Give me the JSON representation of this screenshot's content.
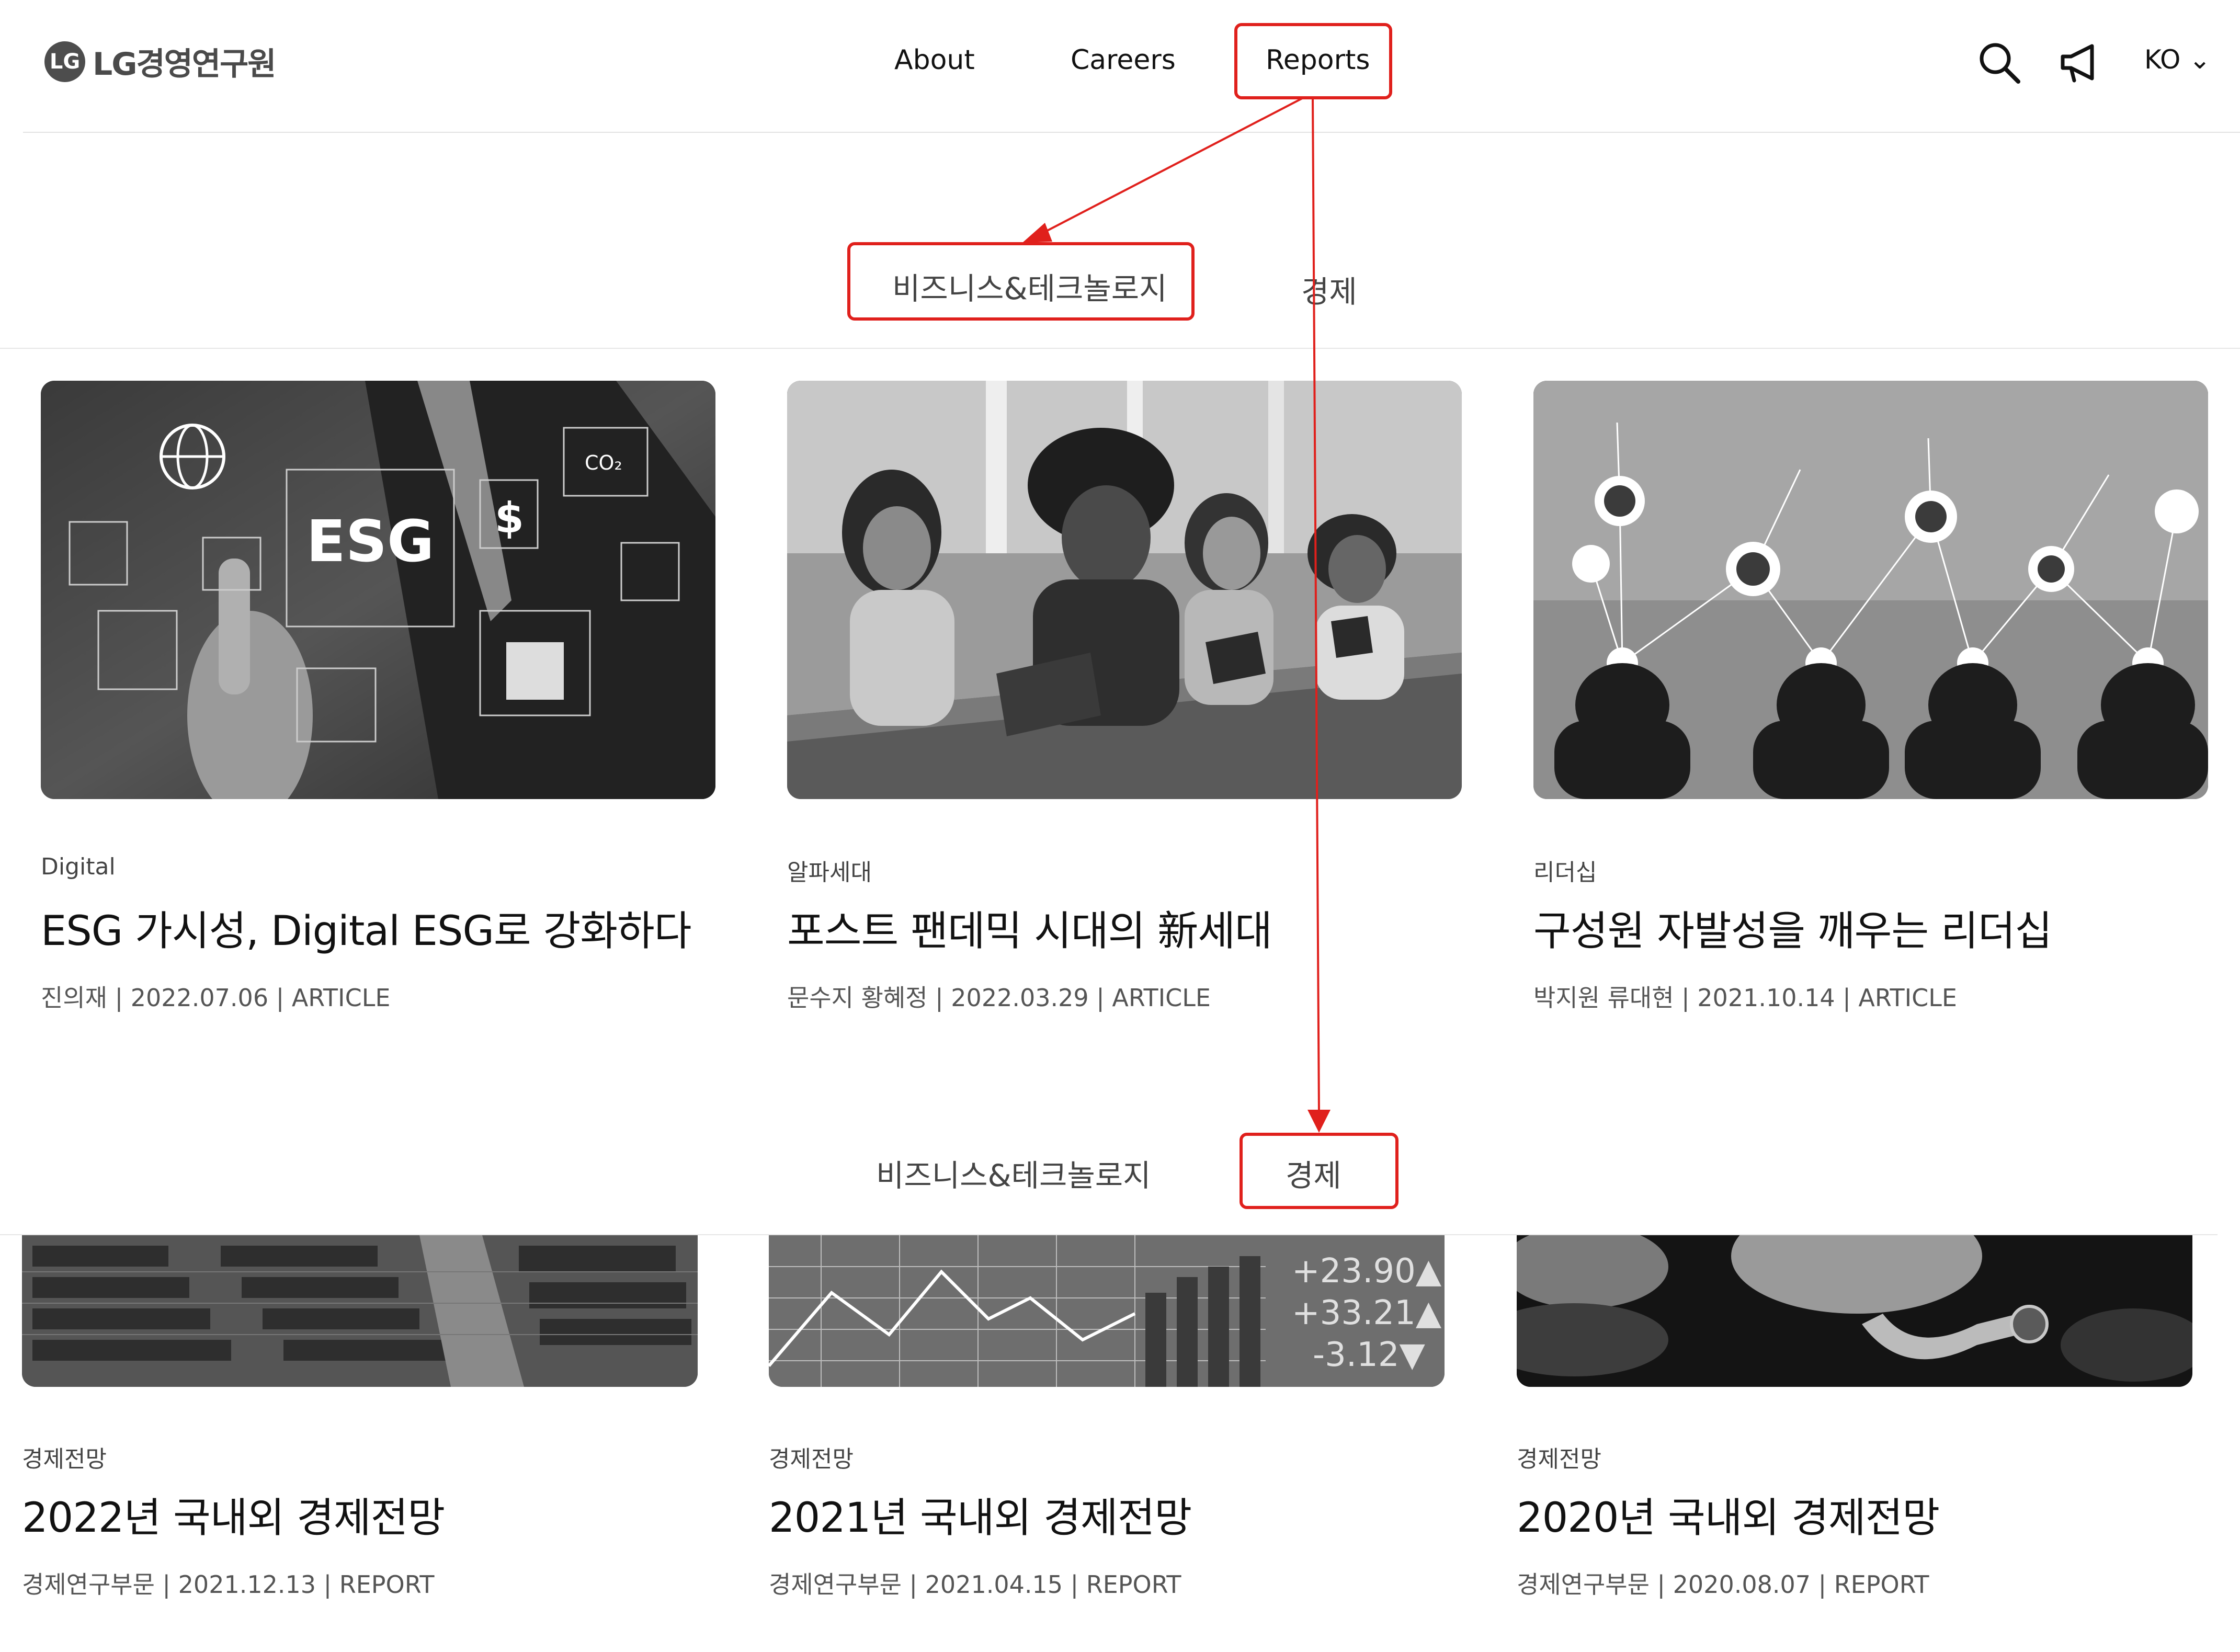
{
  "header": {
    "logo_mark": "LG",
    "logo_text": "LG경영연구원",
    "nav": [
      "About",
      "Careers",
      "Reports"
    ],
    "language": "KO ⌄",
    "icons": [
      "search-icon",
      "megaphone-icon",
      "chevron-down-icon"
    ]
  },
  "section1": {
    "tabs": [
      "비즈니스&테크놀로지",
      "경제"
    ],
    "cards": [
      {
        "category": "Digital",
        "title": "ESG 가시성, Digital ESG로 강화하다",
        "meta": "진의재 | 2022.07.06 | ARTICLE"
      },
      {
        "category": "알파세대",
        "title": "포스트 팬데믹 시대의 新세대",
        "meta": "문수지 황혜정 | 2022.03.29 | ARTICLE"
      },
      {
        "category": "리더십",
        "title": "구성원 자발성을 깨우는 리더십",
        "meta": "박지원 류대현 | 2021.10.14 | ARTICLE"
      }
    ]
  },
  "section2": {
    "tabs": [
      "비즈니스&테크놀로지",
      "경제"
    ],
    "cards": [
      {
        "category": "경제전망",
        "title": "2022년 국내외 경제전망",
        "meta": "경제연구부문 | 2021.12.13 | REPORT"
      },
      {
        "category": "경제전망",
        "title": "2021년 국내외 경제전망",
        "meta": "경제연구부문 | 2021.04.15 | REPORT"
      },
      {
        "category": "경제전망",
        "title": "2020년 국내외 경제전망",
        "meta": "경제연구부문 | 2020.08.07 | REPORT"
      }
    ]
  },
  "image_text": {
    "esg": "ESG",
    "dollar": "$",
    "co2": "CO₂",
    "ticker": [
      "+23.90▲",
      "+33.21▲",
      "-3.12▼"
    ]
  },
  "colors": {
    "annotation": "#e0201c",
    "text": "#111111",
    "muted": "#555555",
    "divider": "#e2e2e2"
  }
}
